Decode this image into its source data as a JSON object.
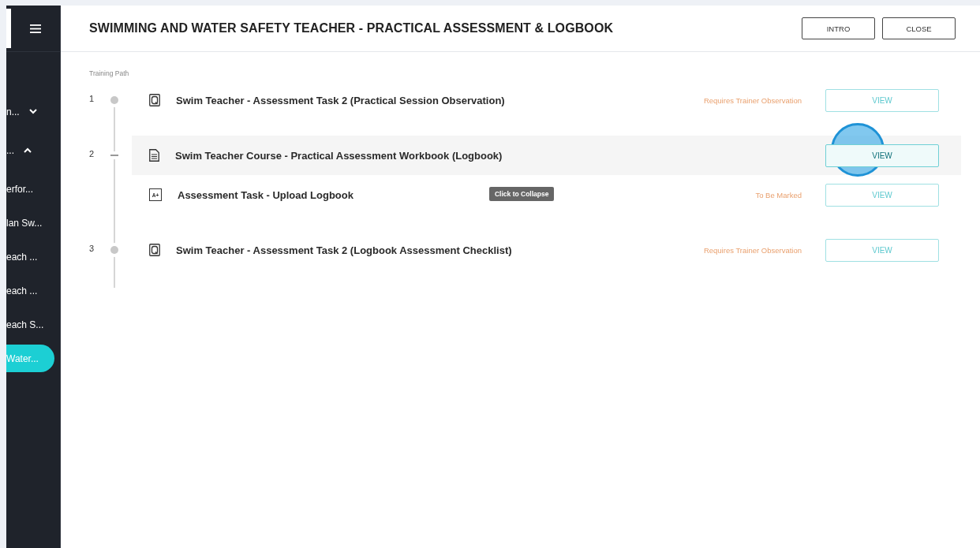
{
  "sidebar": {
    "items": [
      {
        "label": "n...",
        "kind": "group",
        "expanded": false,
        "selected": false
      },
      {
        "label": "...",
        "kind": "group",
        "expanded": true,
        "selected": false
      },
      {
        "label": "erfor...",
        "kind": "link",
        "selected": false
      },
      {
        "label": "lan Sw...",
        "kind": "link",
        "selected": false
      },
      {
        "label": "each ...",
        "kind": "link",
        "selected": false
      },
      {
        "label": "each ...",
        "kind": "link",
        "selected": false
      },
      {
        "label": "each S...",
        "kind": "link",
        "selected": false
      },
      {
        "label": "Water...",
        "kind": "link",
        "selected": true
      }
    ]
  },
  "header": {
    "title": "SWIMMING AND WATER SAFETY TEACHER - PRACTICAL ASSESSMENT & LOGBOOK",
    "buttons": [
      "INTRO",
      "CLOSE"
    ]
  },
  "training_path": {
    "label": "Training Path",
    "steps": [
      {
        "number": "1",
        "expanded": false,
        "highlighted": false,
        "kind": "quiz",
        "title": "Swim Teacher - Assessment Task 2 (Practical Session Observation)",
        "status": "Requires Trainer Observation",
        "button": "VIEW"
      },
      {
        "number": "2",
        "expanded": true,
        "highlighted": true,
        "kind": "document",
        "title": "Swim Teacher Course - Practical Assessment Workbook (Logbook)",
        "button": "VIEW",
        "children": [
          {
            "kind": "grade",
            "icon_text": "A+",
            "highlighted": false,
            "title": "Assessment Task - Upload Logbook",
            "tooltip": "Click to Collapse",
            "status": "To Be Marked",
            "button": "VIEW"
          }
        ]
      },
      {
        "number": "3",
        "expanded": false,
        "highlighted": false,
        "kind": "quiz",
        "title": "Swim Teacher - Assessment Task 2 (Logbook Assessment Checklist)",
        "status": "Requires Trainer Observation",
        "button": "VIEW"
      }
    ]
  }
}
